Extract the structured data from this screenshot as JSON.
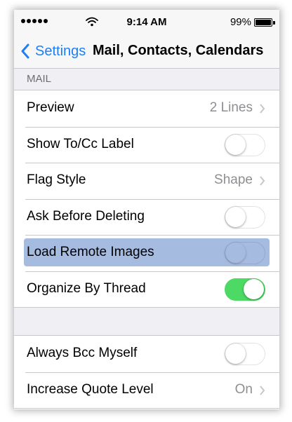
{
  "status_bar": {
    "time": "9:14 AM",
    "battery_percent": "99%",
    "signal_bars": 5,
    "icons": [
      "signal-dots-icon",
      "wifi-icon",
      "battery-icon"
    ]
  },
  "nav": {
    "back_label": "Settings",
    "title": "Mail, Contacts, Calendars"
  },
  "mail_section": {
    "header": "MAIL",
    "rows": [
      {
        "label": "Preview",
        "value": "2 Lines",
        "type": "disclosure"
      },
      {
        "label": "Show To/Cc Label",
        "type": "toggle",
        "on": false
      },
      {
        "label": "Flag Style",
        "value": "Shape",
        "type": "disclosure"
      },
      {
        "label": "Ask Before Deleting",
        "type": "toggle",
        "on": false
      },
      {
        "label": "Load Remote Images",
        "type": "toggle",
        "on": false,
        "highlighted": true
      },
      {
        "label": "Organize By Thread",
        "type": "toggle",
        "on": true
      }
    ]
  },
  "second_section": {
    "rows": [
      {
        "label": "Always Bcc Myself",
        "type": "toggle",
        "on": false
      },
      {
        "label": "Increase Quote Level",
        "value": "On",
        "type": "disclosure"
      }
    ]
  },
  "colors": {
    "accent": "#1e7ff5",
    "toggle_on": "#4cd964",
    "highlight": "#a6bbe0",
    "group_background": "#efeff4"
  }
}
